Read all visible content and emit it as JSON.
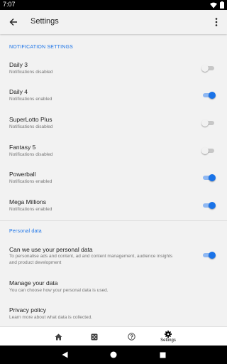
{
  "status_bar": {
    "time": "7:07"
  },
  "app_bar": {
    "title": "Settings"
  },
  "notification_section": {
    "header": "NOTIFICATION SETTINGS"
  },
  "notifications": [
    {
      "title": "Daily 3",
      "subtitle": "Notifications disabled",
      "enabled": false
    },
    {
      "title": "Daily 4",
      "subtitle": "Notifications enabled",
      "enabled": true
    },
    {
      "title": "SuperLotto Plus",
      "subtitle": "Notifications disabled",
      "enabled": false
    },
    {
      "title": "Fantasy 5",
      "subtitle": "Notifications disabled",
      "enabled": false
    },
    {
      "title": "Powerball",
      "subtitle": "Notifications enabled",
      "enabled": true
    },
    {
      "title": "Mega Millions",
      "subtitle": "Notifications enabled",
      "enabled": true
    }
  ],
  "personal_section": {
    "header": "Personal data"
  },
  "personal": [
    {
      "title": "Can we use your personal data",
      "subtitle": "To personalise ads and content, ad and content management, audience insights and product development",
      "enabled": true
    },
    {
      "title": "Manage your data",
      "subtitle": "You can choose how your personal data is used."
    },
    {
      "title": "Privacy policy",
      "subtitle": "Learn more about what data is collected."
    }
  ],
  "bottom_nav": {
    "settings_label": "Settings",
    "active": "settings"
  },
  "colors": {
    "accent": "#1a73e8",
    "background": "#f2f2f2"
  }
}
